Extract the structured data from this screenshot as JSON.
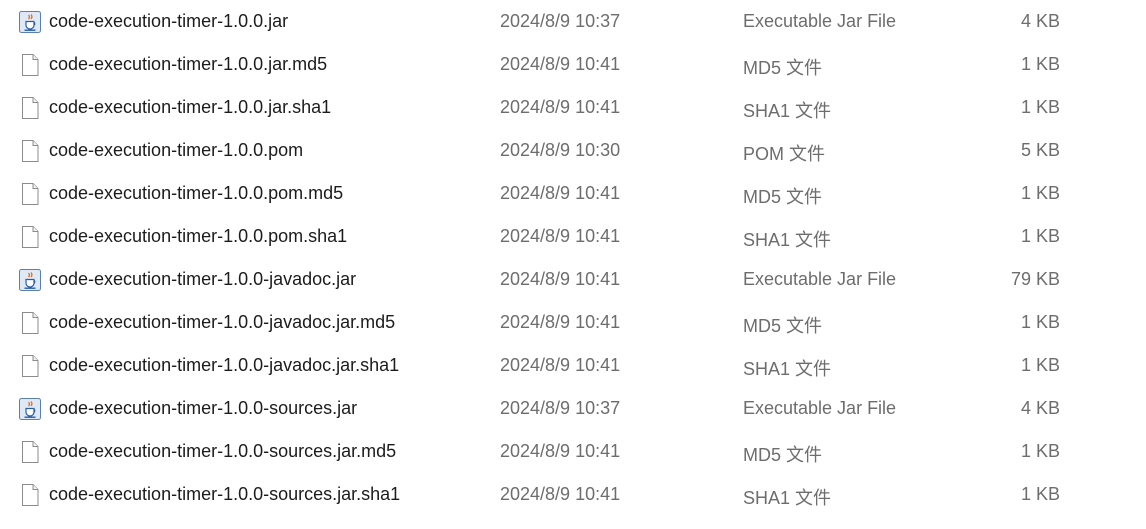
{
  "files": [
    {
      "name": "code-execution-timer-1.0.0.jar",
      "modified": "2024/8/9 10:37",
      "type": "Executable Jar File",
      "size": "4 KB",
      "icon": "jar-icon"
    },
    {
      "name": "code-execution-timer-1.0.0.jar.md5",
      "modified": "2024/8/9 10:41",
      "type": "MD5 文件",
      "size": "1 KB",
      "icon": "file-icon"
    },
    {
      "name": "code-execution-timer-1.0.0.jar.sha1",
      "modified": "2024/8/9 10:41",
      "type": "SHA1 文件",
      "size": "1 KB",
      "icon": "file-icon"
    },
    {
      "name": "code-execution-timer-1.0.0.pom",
      "modified": "2024/8/9 10:30",
      "type": "POM 文件",
      "size": "5 KB",
      "icon": "file-icon"
    },
    {
      "name": "code-execution-timer-1.0.0.pom.md5",
      "modified": "2024/8/9 10:41",
      "type": "MD5 文件",
      "size": "1 KB",
      "icon": "file-icon"
    },
    {
      "name": "code-execution-timer-1.0.0.pom.sha1",
      "modified": "2024/8/9 10:41",
      "type": "SHA1 文件",
      "size": "1 KB",
      "icon": "file-icon"
    },
    {
      "name": "code-execution-timer-1.0.0-javadoc.jar",
      "modified": "2024/8/9 10:41",
      "type": "Executable Jar File",
      "size": "79 KB",
      "icon": "jar-icon"
    },
    {
      "name": "code-execution-timer-1.0.0-javadoc.jar.md5",
      "modified": "2024/8/9 10:41",
      "type": "MD5 文件",
      "size": "1 KB",
      "icon": "file-icon"
    },
    {
      "name": "code-execution-timer-1.0.0-javadoc.jar.sha1",
      "modified": "2024/8/9 10:41",
      "type": "SHA1 文件",
      "size": "1 KB",
      "icon": "file-icon"
    },
    {
      "name": "code-execution-timer-1.0.0-sources.jar",
      "modified": "2024/8/9 10:37",
      "type": "Executable Jar File",
      "size": "4 KB",
      "icon": "jar-icon"
    },
    {
      "name": "code-execution-timer-1.0.0-sources.jar.md5",
      "modified": "2024/8/9 10:41",
      "type": "MD5 文件",
      "size": "1 KB",
      "icon": "file-icon"
    },
    {
      "name": "code-execution-timer-1.0.0-sources.jar.sha1",
      "modified": "2024/8/9 10:41",
      "type": "SHA1 文件",
      "size": "1 KB",
      "icon": "file-icon"
    }
  ]
}
